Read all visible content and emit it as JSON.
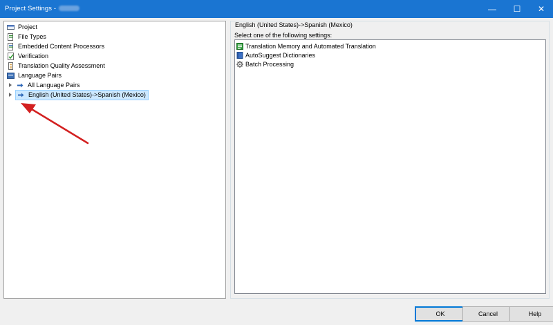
{
  "window": {
    "title": "Project Settings -",
    "minimize_glyph": "—",
    "maximize_glyph": "☐",
    "close_glyph": "✕"
  },
  "tree": {
    "items": [
      {
        "label": "Project",
        "icon": "project-icon"
      },
      {
        "label": "File Types",
        "icon": "file-types-icon"
      },
      {
        "label": "Embedded Content Processors",
        "icon": "embedded-content-icon"
      },
      {
        "label": "Verification",
        "icon": "verification-icon"
      },
      {
        "label": "Translation Quality Assessment",
        "icon": "quality-assessment-icon"
      },
      {
        "label": "Language Pairs",
        "icon": "language-pairs-icon"
      },
      {
        "label": "All Language Pairs",
        "icon": "arrow-right-icon"
      },
      {
        "label": "English (United States)->Spanish (Mexico)",
        "icon": "arrow-right-icon",
        "selected": true
      }
    ]
  },
  "right": {
    "header": "English (United States)->Spanish (Mexico)",
    "select_label": "Select one of the following settings:",
    "settings": [
      {
        "label": "Translation Memory and Automated Translation",
        "icon": "translation-memory-icon"
      },
      {
        "label": "AutoSuggest Dictionaries",
        "icon": "book-icon"
      },
      {
        "label": "Batch Processing",
        "icon": "gear-icon"
      }
    ]
  },
  "buttons": {
    "ok": "OK",
    "cancel": "Cancel",
    "help": "Help"
  },
  "colors": {
    "titlebar": "#1a75d2",
    "selection": "#cce8ff",
    "annotation_arrow": "#d32020"
  }
}
